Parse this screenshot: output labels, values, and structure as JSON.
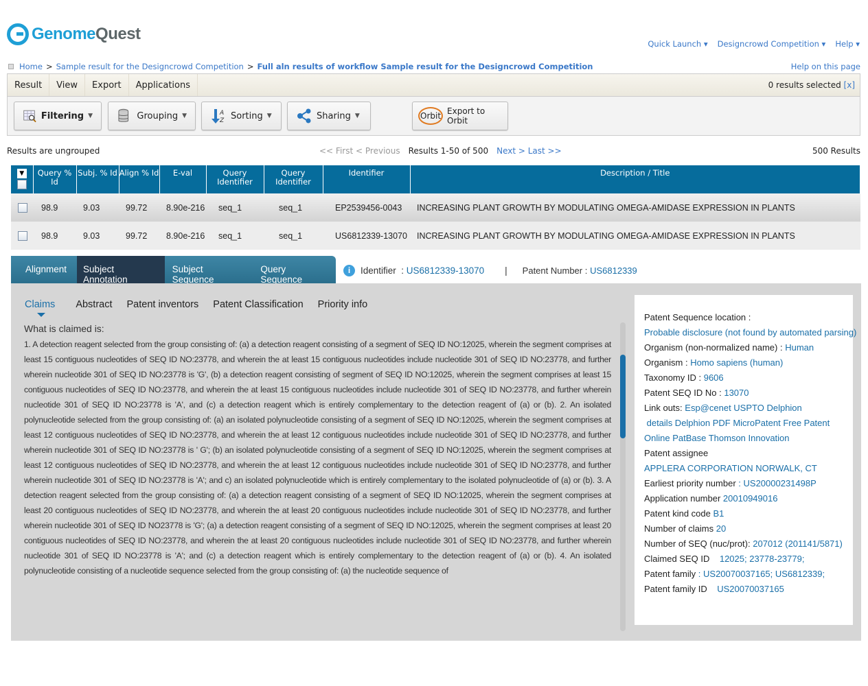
{
  "brand": {
    "name_a": "Genome",
    "name_b": "Quest"
  },
  "top_links": [
    "Quick Launch ▾",
    "Designcrowd Competition ▾",
    "Help ▾"
  ],
  "breadcrumb": {
    "home": "Home",
    "parent": "Sample result for the Designcrowd Competition",
    "current": "Full aln results of workflow Sample result for the Designcrowd Competition",
    "sep": ">"
  },
  "help_page": "Help on this page",
  "menu": [
    "Result",
    "View",
    "Export",
    "Applications"
  ],
  "selection": {
    "text": "0 results selected",
    "clear": "[x]"
  },
  "toolbar": {
    "filtering": "Filtering",
    "grouping": "Grouping",
    "sorting": "Sorting",
    "sharing": "Sharing",
    "orbit_logo": "Orbit",
    "export_orbit": "Export to Orbit"
  },
  "results": {
    "grouping": "Results are ungrouped",
    "first": "<< First",
    "previous": "< Previous",
    "range": "Results 1-50 of 500",
    "next": "Next >",
    "last": "Last >>",
    "total": "500 Results"
  },
  "table": {
    "headers": [
      "Query % Id",
      "Subj. % Id",
      "Align % Id",
      "E-val",
      "Query Identifier",
      "Query Identifier",
      "Identifier",
      "Description / Title"
    ],
    "rows": [
      [
        "98.9",
        "9.03",
        "99.72",
        "8.90e-216",
        "seq_1",
        "seq_1",
        "EP2539456-0043",
        "INCREASING PLANT GROWTH BY MODULATING OMEGA-AMIDASE EXPRESSION IN PLANTS"
      ],
      [
        "98.9",
        "9.03",
        "99.72",
        "8.90e-216",
        "seq_1",
        "seq_1",
        "US6812339-13070",
        "INCREASING PLANT GROWTH BY MODULATING OMEGA-AMIDASE EXPRESSION IN PLANTS"
      ]
    ]
  },
  "detail_tabs": [
    "Alignment",
    "Subject Annotation",
    "Subject Sequence",
    "Query Sequence"
  ],
  "detail_header": {
    "id_label": "Identifier  :",
    "id_value": "US6812339-13070",
    "sep": "|",
    "patent_label": "Patent Number :",
    "patent_value": "US6812339"
  },
  "sub_tabs": [
    "Claims",
    "Abstract",
    "Patent inventors",
    "Patent Classification",
    "Priority info"
  ],
  "claims": {
    "heading": "What is claimed is:",
    "text": "1. A detection reagent selected from the group consisting of: (a) a detection reagent consisting of a segment of SEQ ID NO:12025, wherein the segment comprises at least 15 contiguous nucleotides of SEQ ID NO:23778, and wherein the at least 15 contiguous nucleotides include nucleotide 301 of SEQ ID NO:23778, and further wherein nucleotide 301 of SEQ ID NO:23778 is 'G', (b) a detection reagent consisting of segment of SEQ ID NO:12025, wherein the segment comprises at least 15 contiguous nucleotides of SEQ ID NO:23778, and wherein the at least 15 contiguous nucleotides include nucleotide 301 of SEQ ID NO:23778, and further wherein nucleotide 301 of SEQ ID NO:23778 is 'A', and (c) a detection reagent which is entirely complementary to the detection reagent of (a) or (b). 2. An isolated polynucleotide selected from the group consisting of: (a) an isolated polynucleotide consisting of a segment of SEQ ID NO:12025, wherein the segment comprises at least 12 contiguous nucleotides of SEQ ID NO:23778, and wherein the at least 12 contiguous nucleotides include nucleotide 301 of SEQ ID NO:23778, and further wherein nucleotide 301 of SEQ ID NO:23778 is ' G'; (b) an isolated polynucleotide consisting of a segment of SEQ ID NO:12025, wherein the segment comprises at least 12 contiguous nucleotides of SEQ ID NO:23778, and wherein the at least 12 contiguous nucleotides include nucleotide 301 of SEQ ID NO:23778, and further wherein nucleotide 301 of SEQ ID NO:23778 is 'A'; and c) an isolated polynucleotide which is entirely complementary to the isolated polynucleotide of (a) or (b). 3. A detection reagent selected from the group consisting of: (a) a detection reagent consisting of a segment of SEQ ID NO:12025, wherein the segment comprises at least 20 contiguous nucleotides of SEQ ID NO:23778, and wherein the at least 20 contiguous nucleotides include nucleotide 301 of SEQ ID NO:23778, and further wherein nucleotide 301 of SEQ ID NO23778 is 'G'; (a) a detection reagent consisting of a segment of SEQ ID NO:12025, wherein the segment comprises at least 20 contiguous nucleotides of SEQ ID NO:23778, and wherein the at least 20 contiguous nucleotides include nucleotide 301 of SEQ ID NO:23778, and further wherein nucleotide 301 of SEQ ID NO:23778 is 'A'; and (c) a detection reagent which is entirely complementary to the detection reagent of (a) or (b). 4. An isolated polynucleotide consisting of a nucleotide sequence selected from the group consisting of: (a) the nucleotide sequence of"
  },
  "info": [
    {
      "label": "Patent Sequence location :",
      "value": ""
    },
    {
      "label": "",
      "value": "Probable disclosure (not found by automated parsing)"
    },
    {
      "label": "Organism (non-normalized name) :",
      "value": "Human"
    },
    {
      "label": "Organism :",
      "value": "Homo sapiens (human)"
    },
    {
      "label": "Taxonomy ID :",
      "value": "9606"
    },
    {
      "label": "Patent SEQ ID No :",
      "value": "13070"
    },
    {
      "label": "Link outs:",
      "value": "Esp@cenet USPTO Delphion"
    },
    {
      "label": "",
      "value": " details Delphion PDF MicroPatent Free Patent"
    },
    {
      "label": "",
      "value": "Online PatBase Thomson Innovation"
    },
    {
      "label": "Patent assignee",
      "value": ""
    },
    {
      "label": "",
      "value": "APPLERA CORPORATION NORWALK, CT"
    },
    {
      "label": "Earliest priority number",
      "value": ": US20000231498P"
    },
    {
      "label": "Application number",
      "value": "20010949016"
    },
    {
      "label": "Patent kind code",
      "value": "B1"
    },
    {
      "label": "Number of claims",
      "value": "20"
    },
    {
      "label": "Number of SEQ (nuc/prot):",
      "value": "207012 (201141/5871)"
    },
    {
      "label": "Claimed SEQ ID",
      "value": "   12025; 23778-23779;"
    },
    {
      "label": "Patent family",
      "value": ": US20070037165; US6812339;"
    },
    {
      "label": "Patent family ID",
      "value": "   US20070037165"
    }
  ]
}
